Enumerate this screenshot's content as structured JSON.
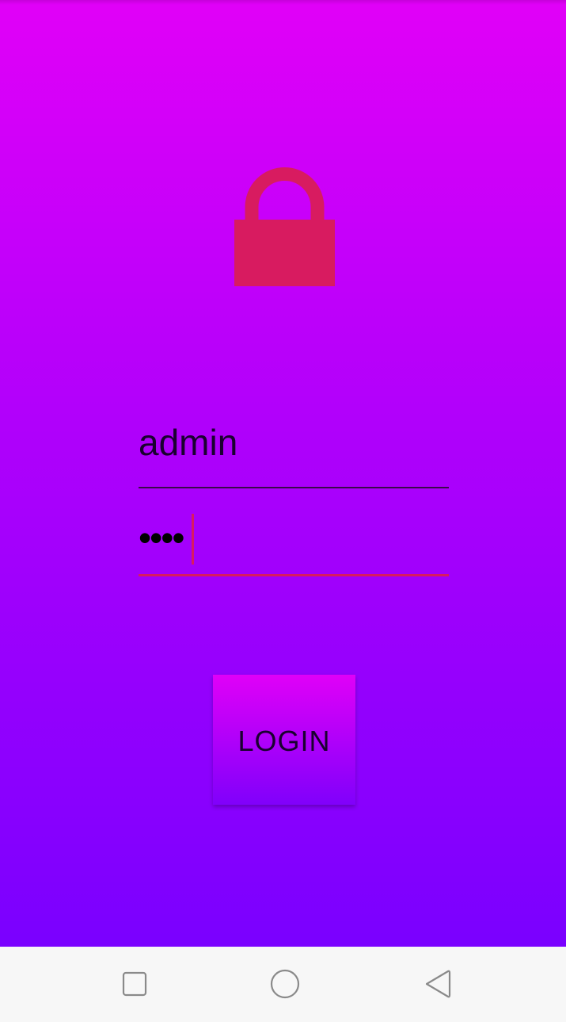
{
  "login": {
    "username_value": "admin",
    "password_value": "••••",
    "button_label": "LOGIN"
  },
  "icons": {
    "lock": "lock-icon",
    "nav_recents": "square-icon",
    "nav_home": "circle-icon",
    "nav_back": "triangle-back-icon"
  },
  "colors": {
    "gradient_top": "#e100f8",
    "gradient_bottom": "#7a00ff",
    "accent": "#d81b60",
    "navbar_bg": "#f7f7f7"
  }
}
